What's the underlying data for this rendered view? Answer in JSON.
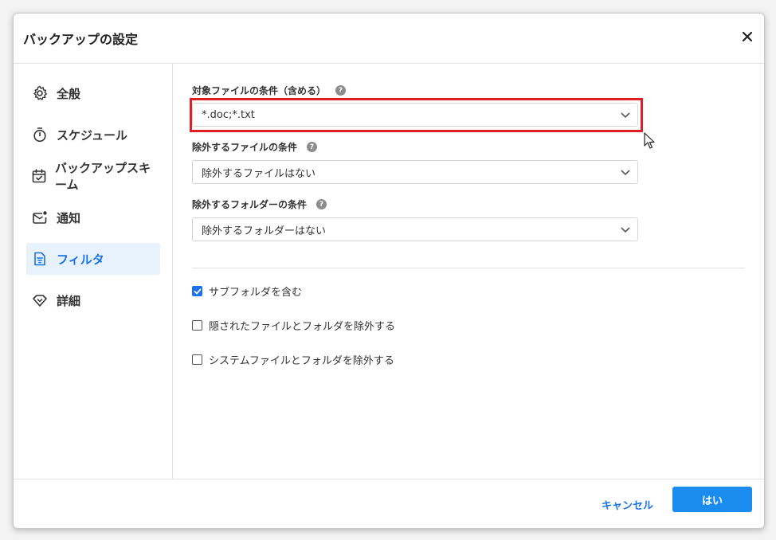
{
  "dialog": {
    "title": "バックアップの設定",
    "close_icon": "close-icon"
  },
  "sidebar": {
    "items": [
      {
        "label": "全般",
        "icon": "gear-icon",
        "active": false
      },
      {
        "label": "スケジュール",
        "icon": "timer-icon",
        "active": false
      },
      {
        "label": "バックアップスキーム",
        "icon": "calendar-check-icon",
        "active": false
      },
      {
        "label": "通知",
        "icon": "mail-icon",
        "active": false
      },
      {
        "label": "フィルタ",
        "icon": "document-filter-icon",
        "active": true
      },
      {
        "label": "詳細",
        "icon": "diamond-icon",
        "active": false
      }
    ]
  },
  "filter": {
    "include": {
      "label": "対象ファイルの条件（含める）",
      "value": "*.doc;*.txt"
    },
    "exclude_files": {
      "label": "除外するファイルの条件",
      "value": "除外するファイルはない"
    },
    "exclude_folders": {
      "label": "除外するフォルダーの条件",
      "value": "除外するフォルダーはない"
    },
    "help_glyph": "?",
    "options": [
      {
        "label": "サブフォルダを含む",
        "checked": true
      },
      {
        "label": "隠されたファイルとフォルダを除外する",
        "checked": false
      },
      {
        "label": "システムファイルとフォルダを除外する",
        "checked": false
      }
    ]
  },
  "footer": {
    "cancel_label": "キャンセル",
    "ok_label": "はい"
  },
  "colors": {
    "accent": "#1a73e8",
    "primary_button": "#1a8cf0",
    "highlight": "#e01e25",
    "active_nav_bg": "#e8f2fd"
  }
}
